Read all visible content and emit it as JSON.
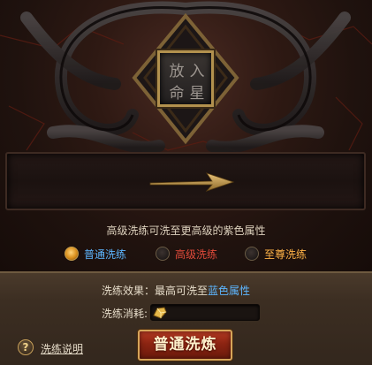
{
  "gem_slot": {
    "chars": [
      "放",
      "入",
      "命",
      "星"
    ]
  },
  "description": "高级洗练可洗至更高级的紫色属性",
  "refine_options": [
    {
      "label": "普通洗练",
      "selected": true,
      "color": "#5db6ff"
    },
    {
      "label": "高级洗练",
      "selected": false,
      "color": "#e04a3a"
    },
    {
      "label": "至尊洗练",
      "selected": false,
      "color": "#ffb347"
    }
  ],
  "effect": {
    "prefix": "洗练效果：最高可洗至",
    "highlight": "蓝色属性"
  },
  "cost": {
    "label": "洗练消耗:",
    "icon": "gold-ingot-icon"
  },
  "help": {
    "icon_glyph": "?",
    "label": "洗练说明"
  },
  "action_button": {
    "label": "普通洗炼"
  }
}
